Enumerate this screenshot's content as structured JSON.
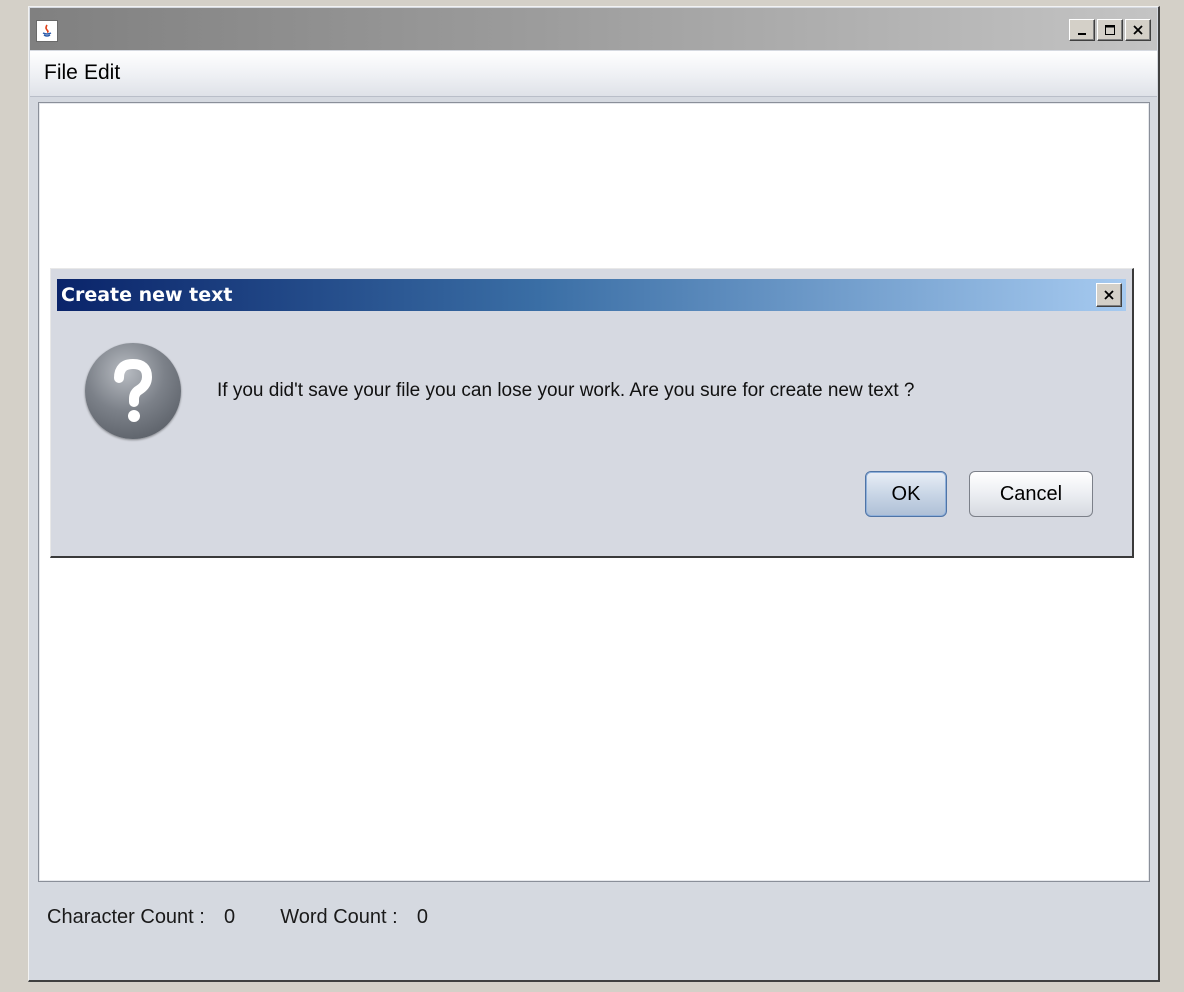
{
  "window": {
    "title": "",
    "menu": [
      {
        "label": "File"
      },
      {
        "label": "Edit"
      }
    ],
    "status": {
      "character_count_label": "Character Count :",
      "character_count_value": "0",
      "word_count_label": "Word Count :",
      "word_count_value": "0"
    }
  },
  "dialog": {
    "title": "Create new text",
    "message": "If you did't save your file you can lose your work.  Are you sure for create new text ?",
    "ok_label": "OK",
    "cancel_label": "Cancel",
    "icon": "question-icon"
  },
  "colors": {
    "dialog_title_start": "#0a246a",
    "dialog_title_end": "#a6caf0",
    "ok_border": "#4f74a6"
  }
}
